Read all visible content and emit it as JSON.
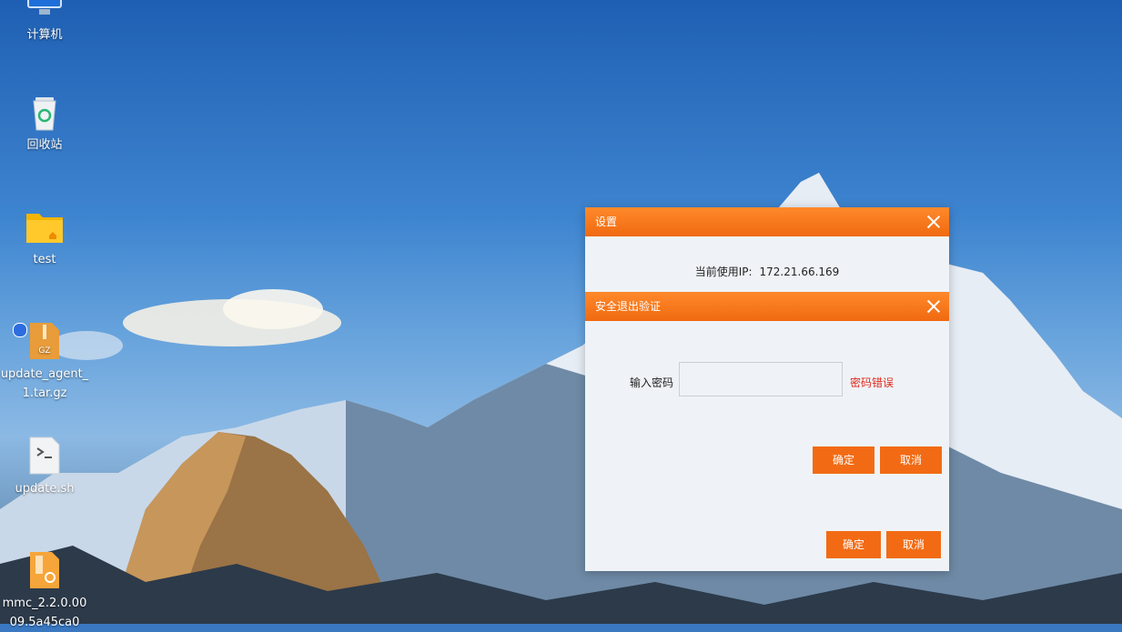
{
  "desktop": {
    "icons": [
      {
        "label": "计算机",
        "icon": "computer-icon"
      },
      {
        "label": "回收站",
        "icon": "recycle-bin-icon"
      },
      {
        "label": "test",
        "icon": "folder-icon"
      },
      {
        "label": "update_agent_1.tar.gz",
        "icon": "archive-icon"
      },
      {
        "label": "update.sh",
        "icon": "script-icon"
      },
      {
        "label": "mmc_2.2.0.0009.5a45ca0",
        "icon": "package-icon"
      }
    ]
  },
  "settings_dialog": {
    "title": "设置",
    "ip_label": "当前使用IP:",
    "ip_value": "172.21.66.169",
    "confirm_label": "确定",
    "cancel_label": "取消"
  },
  "exit_dialog": {
    "title": "安全退出验证",
    "password_label": "输入密码",
    "password_value": "",
    "password_placeholder": "",
    "error_text": "密码错误",
    "confirm_label": "确定",
    "cancel_label": "取消"
  },
  "colors": {
    "accent": "#f26b14",
    "header_start": "#ff8a2b",
    "dialog_bg": "#eff3f7",
    "error": "#e02a1d"
  }
}
